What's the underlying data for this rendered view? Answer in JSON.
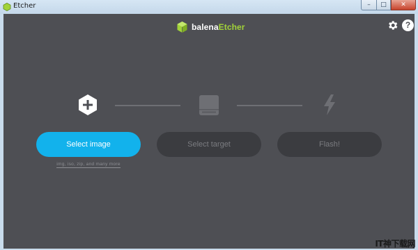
{
  "window": {
    "title": "Etcher",
    "controls": {
      "minimize": "–",
      "maximize": "□",
      "close": "✕"
    }
  },
  "brand": {
    "part1": "balena",
    "part2": "Etcher",
    "logo_icon": "cube-icon",
    "accent": "#a2d339"
  },
  "header_icons": {
    "settings": "gear-icon",
    "help": "?"
  },
  "steps": [
    {
      "icon": "plus-hexagon-icon",
      "button": "Select image",
      "state": "active",
      "hint": "img, iso, zip, and many more"
    },
    {
      "icon": "drive-icon",
      "button": "Select target",
      "state": "disabled"
    },
    {
      "icon": "lightning-icon",
      "button": "Flash!",
      "state": "disabled"
    }
  ],
  "colors": {
    "background": "#4e4f54",
    "primary": "#12b2ec",
    "disabled_button": "#3b3c40",
    "disabled_text": "#7b7c80"
  },
  "watermark": "IT神下载网"
}
